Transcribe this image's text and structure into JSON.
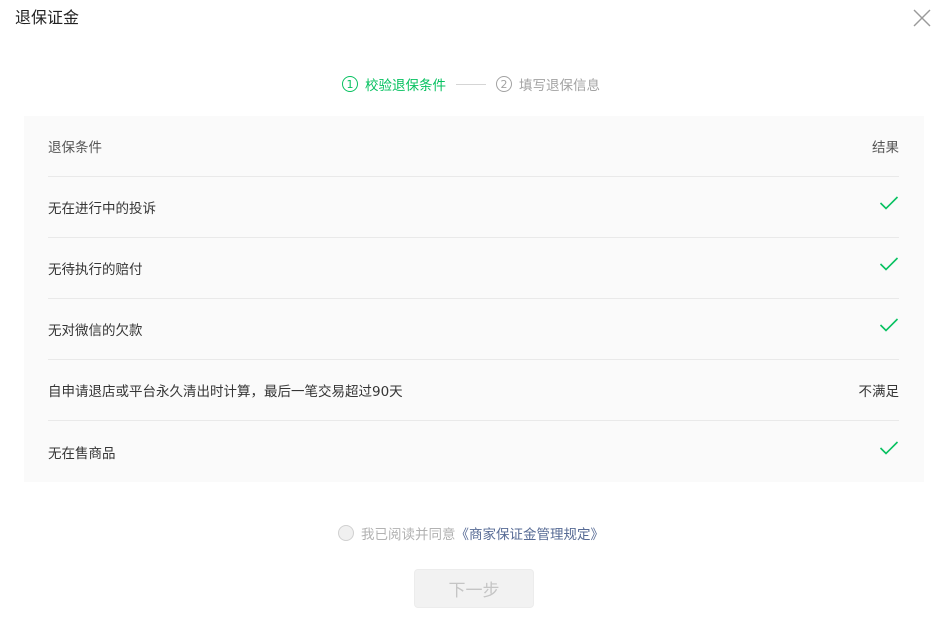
{
  "dialog": {
    "title": "退保证金",
    "close_icon": "close-icon"
  },
  "steps": [
    {
      "number": "1",
      "label": "校验退保条件",
      "state": "active"
    },
    {
      "number": "2",
      "label": "填写退保信息",
      "state": "inactive"
    }
  ],
  "colors": {
    "accent": "#07c160",
    "inactive": "#a2a2a2",
    "link": "#576b95"
  },
  "table": {
    "headers": {
      "condition": "退保条件",
      "result": "结果"
    },
    "rows": [
      {
        "condition": "无在进行中的投诉",
        "result_icon": "check-icon",
        "result_text": ""
      },
      {
        "condition": "无待执行的赔付",
        "result_icon": "check-icon",
        "result_text": ""
      },
      {
        "condition": "无对微信的欠款",
        "result_icon": "check-icon",
        "result_text": ""
      },
      {
        "condition": "自申请退店或平台永久清出时计算，最后一笔交易超过90天",
        "result_icon": "",
        "result_text": "不满足"
      },
      {
        "condition": "无在售商品",
        "result_icon": "check-icon",
        "result_text": ""
      }
    ]
  },
  "agreement": {
    "text": "我已阅读并同意",
    "link": "《商家保证金管理规定》",
    "checked": false
  },
  "footer": {
    "next_label": "下一步",
    "next_disabled": true
  }
}
